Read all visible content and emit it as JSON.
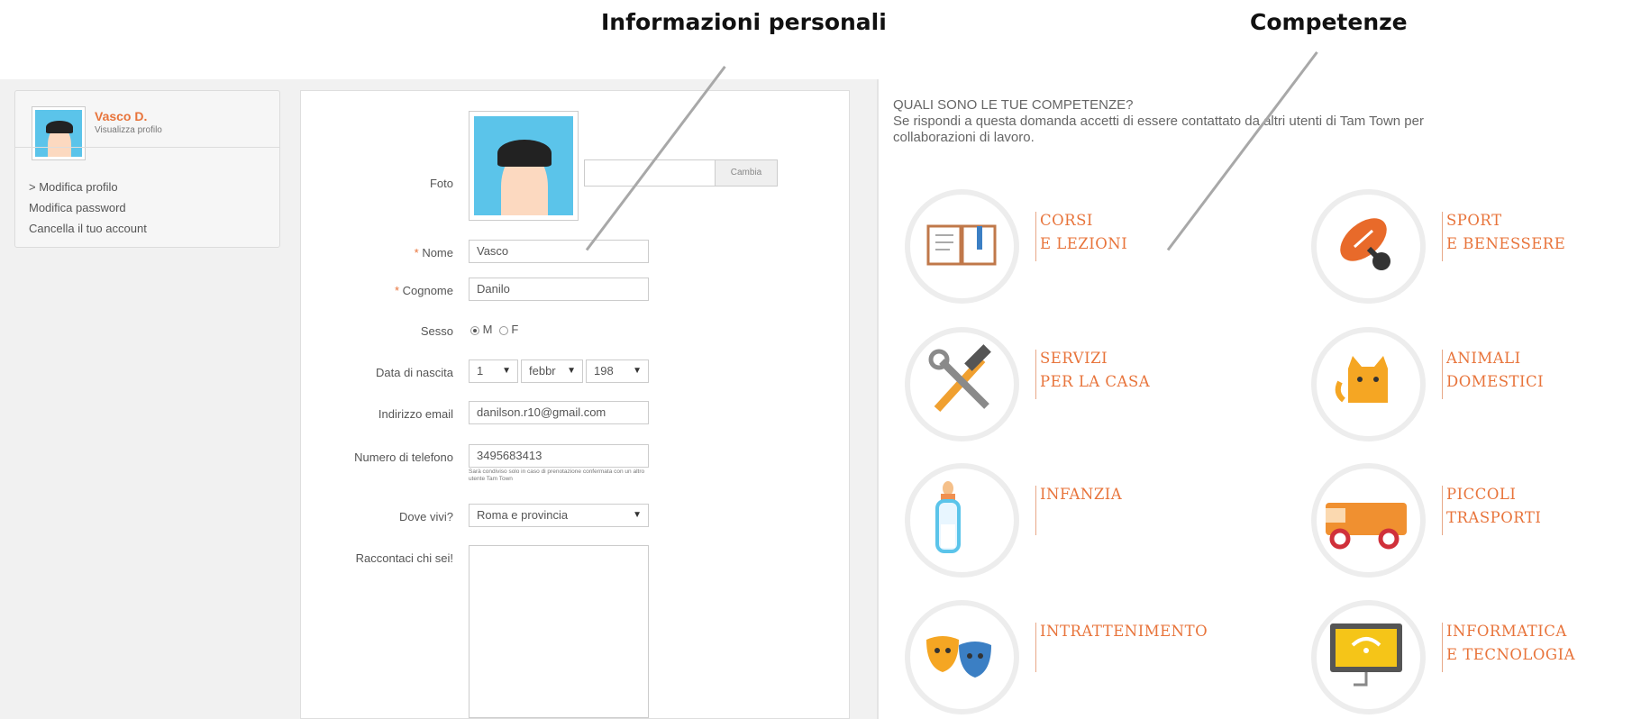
{
  "annotations": {
    "personal_info": "Informazioni personali",
    "skills": "Competenze"
  },
  "profile_card": {
    "name": "Vasco D.",
    "view_profile": "Visualizza profilo",
    "links": [
      "> Modifica profilo",
      "Modifica password",
      "Cancella il tuo account"
    ]
  },
  "form": {
    "foto_label": "Foto",
    "change_button": "Cambia",
    "required_mark": "*",
    "nome_label": "Nome",
    "nome_value": "Vasco",
    "cognome_label": "Cognome",
    "cognome_value": "Danilo",
    "sesso_label": "Sesso",
    "sesso_options": [
      "M",
      "F"
    ],
    "sesso_selected": "M",
    "birth_label": "Data di nascita",
    "birth_day": "1",
    "birth_month": "febbr",
    "birth_year": "198",
    "email_label": "Indirizzo email",
    "email_value": "danilson.r10@gmail.com",
    "phone_label": "Numero di telefono",
    "phone_value": "3495683413",
    "phone_help": "Sarà condiviso solo in caso di prenotazione confermata con un altro utente Tam Town",
    "location_label": "Dove vivi?",
    "location_value": "Roma e provincia",
    "about_label": "Raccontaci chi sei!"
  },
  "competenze": {
    "question": "QUALI SONO LE TUE COMPETENZE?",
    "description_1": "Se rispondi a questa domanda accetti di essere contattato da altri utenti di Tam Town per",
    "description_2": "collaborazioni di lavoro.",
    "items": [
      {
        "line1": "CORSI",
        "line2": "E LEZIONI",
        "icon": "book-icon"
      },
      {
        "line1": "SPORT",
        "line2": "E BENESSERE",
        "icon": "rugby-ball-icon"
      },
      {
        "line1": "SERVIZI",
        "line2": "PER LA CASA",
        "icon": "tools-icon"
      },
      {
        "line1": "ANIMALI",
        "line2": "DOMESTICI",
        "icon": "cat-icon"
      },
      {
        "line1": "INFANZIA",
        "line2": "",
        "icon": "baby-bottle-icon"
      },
      {
        "line1": "PICCOLI",
        "line2": "TRASPORTI",
        "icon": "van-icon"
      },
      {
        "line1": "INTRATTENIMENTO",
        "line2": "",
        "icon": "theatre-masks-icon"
      },
      {
        "line1": "INFORMATICA",
        "line2": "E TECNOLOGIA",
        "icon": "monitor-icon"
      }
    ]
  },
  "colors": {
    "accent": "#e8743b",
    "avatar_bg": "#5bc4ea",
    "panel_bg": "#f1f1f1"
  }
}
